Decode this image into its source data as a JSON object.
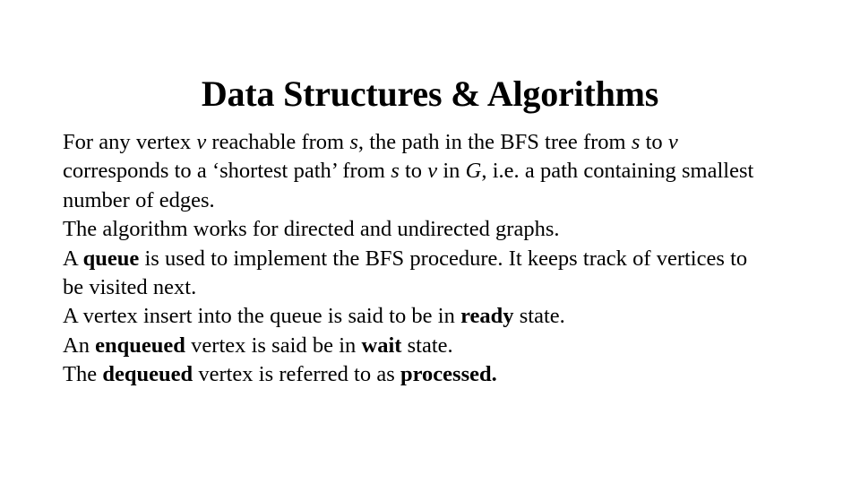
{
  "slide": {
    "title": "Data Structures & Algorithms",
    "paragraphs": [
      {
        "id": "bfs-shortest-path",
        "runs": [
          {
            "text": "For any vertex ",
            "style": "normal"
          },
          {
            "text": "v",
            "style": "italic"
          },
          {
            "text": " reachable from ",
            "style": "normal"
          },
          {
            "text": "s",
            "style": "italic"
          },
          {
            "text": ", the path in the BFS tree from ",
            "style": "normal"
          },
          {
            "text": "s",
            "style": "italic"
          },
          {
            "text": " to ",
            "style": "normal"
          },
          {
            "text": "v",
            "style": "italic"
          },
          {
            "text": " corresponds to a ‘shortest path’ from ",
            "style": "normal"
          },
          {
            "text": "s",
            "style": "italic"
          },
          {
            "text": " to ",
            "style": "normal"
          },
          {
            "text": "v",
            "style": "italic"
          },
          {
            "text": " in ",
            "style": "normal"
          },
          {
            "text": "G",
            "style": "italic"
          },
          {
            "text": ", i.e. a path containing smallest number of edges.",
            "style": "normal"
          }
        ]
      },
      {
        "id": "directed-undirected",
        "runs": [
          {
            "text": "The algorithm works for directed and undirected graphs.",
            "style": "normal"
          }
        ]
      },
      {
        "id": "queue-implements-bfs",
        "runs": [
          {
            "text": "A ",
            "style": "normal"
          },
          {
            "text": "queue",
            "style": "bold"
          },
          {
            "text": " is used to implement the BFS procedure. It keeps track of vertices to be visited next.",
            "style": "normal"
          }
        ]
      },
      {
        "id": "ready-state",
        "runs": [
          {
            "text": "A vertex insert into the queue is said to be in ",
            "style": "normal"
          },
          {
            "text": "ready",
            "style": "bold"
          },
          {
            "text": " state.",
            "style": "normal"
          }
        ]
      },
      {
        "id": "wait-state",
        "runs": [
          {
            "text": "An ",
            "style": "normal"
          },
          {
            "text": "enqueued",
            "style": "bold"
          },
          {
            "text": " vertex is said be in ",
            "style": "normal"
          },
          {
            "text": "wait",
            "style": "bold"
          },
          {
            "text": " state.",
            "style": "normal"
          }
        ]
      },
      {
        "id": "processed-state",
        "runs": [
          {
            "text": "The ",
            "style": "normal"
          },
          {
            "text": "dequeued",
            "style": "bold"
          },
          {
            "text": " vertex is referred to as ",
            "style": "normal"
          },
          {
            "text": "processed.",
            "style": "bold"
          }
        ]
      }
    ],
    "colors": {
      "background": "#ffffff",
      "text": "#000000"
    }
  }
}
